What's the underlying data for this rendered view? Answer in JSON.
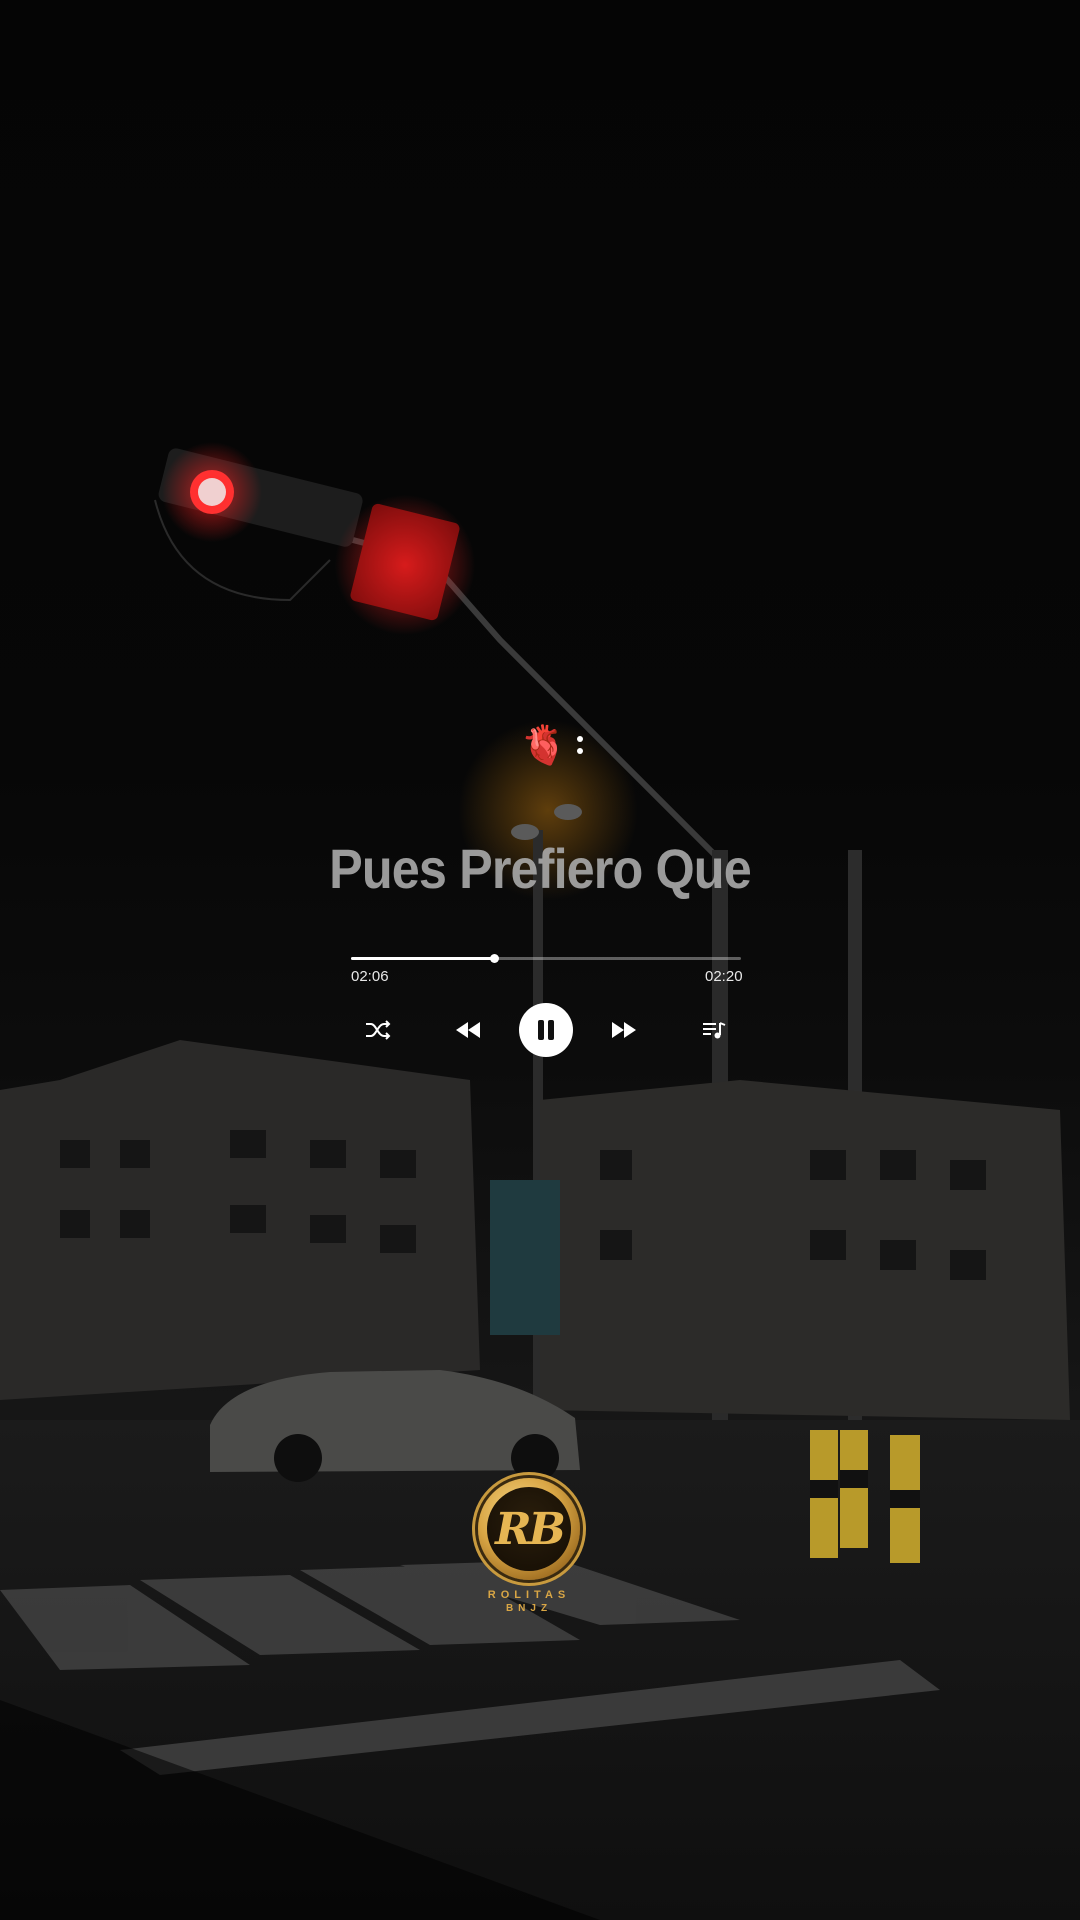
{
  "player": {
    "emoji": "🫀",
    "title": "Pues Prefiero Que",
    "current_time": "02:06",
    "total_time": "02:20",
    "progress": 0.366,
    "state": "playing"
  },
  "controls": {
    "shuffle": "shuffle-icon",
    "previous": "rewind-icon",
    "play_pause": "pause-icon",
    "next": "fast-forward-icon",
    "queue": "playlist-icon"
  },
  "watermark": {
    "monogram": "RB",
    "line1": "ROLITAS",
    "line2": "BNJZ"
  },
  "colors": {
    "accent": "#ffffff",
    "title": "#a7a7a7",
    "logo_gold": "#d9a645"
  }
}
